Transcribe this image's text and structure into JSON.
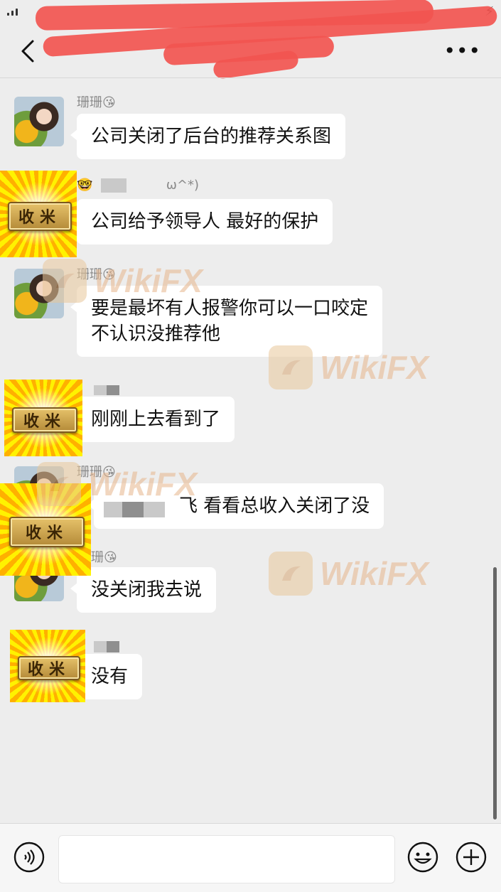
{
  "header": {
    "title_redacted": true
  },
  "messages": [
    {
      "sender": "珊珊",
      "sender_emoji": "😘",
      "text": "公司关闭了后台的推荐关系图"
    },
    {
      "sender_suffix": "ω^*)",
      "sender_emoji": "🤓",
      "text": "公司给予领导人 最好的保护"
    },
    {
      "sender": "珊珊",
      "sender_emoji": "😘",
      "text_line1": "要是最坏有人报警你可以一口咬定",
      "text_line2": "不认识没推荐他"
    },
    {
      "text": "刚刚上去看到了"
    },
    {
      "sender": "珊珊",
      "sender_emoji": "😘",
      "text": "飞 看看总收入关闭了没"
    },
    {
      "sender": "珊",
      "sender_emoji": "😘",
      "text": "没关闭我去说"
    },
    {
      "text": "没有"
    }
  ],
  "sticker": {
    "text": "收米"
  },
  "watermark": {
    "text": "WikiFX"
  },
  "icons": [
    "back-arrow-icon",
    "more-icon",
    "voice-icon",
    "emoji-icon",
    "plus-icon"
  ],
  "colors": {
    "background": "#ededed",
    "bubble": "#ffffff",
    "redaction": "#f25550",
    "watermark": "#e6b58c"
  }
}
